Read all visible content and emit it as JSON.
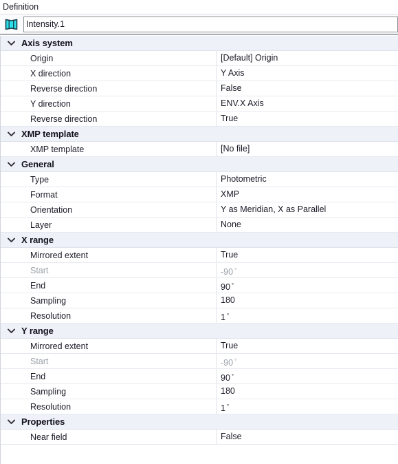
{
  "panel": {
    "title": "Definition"
  },
  "identity": {
    "icon": "light-source-icon",
    "name_value": "Intensity.1",
    "name_placeholder": "Name"
  },
  "icons": {
    "expander": "chevron-down-icon"
  },
  "colors": {
    "icon_fill": "#2ae0ea",
    "icon_stroke": "#1b3a4b",
    "group_row_bg": "#eef2f8",
    "row_border": "#e6eaf0",
    "text": "#1b1b28",
    "disabled_text": "#9aa0a8"
  },
  "groups": [
    {
      "label": "Axis system",
      "expanded": true,
      "rows": [
        {
          "name": "Origin",
          "value": "[Default] Origin",
          "unit": "",
          "disabled": false
        },
        {
          "name": "X direction",
          "value": "Y Axis",
          "unit": "",
          "disabled": false
        },
        {
          "name": "Reverse direction",
          "value": "False",
          "unit": "",
          "disabled": false
        },
        {
          "name": "Y direction",
          "value": "ENV.X Axis",
          "unit": "",
          "disabled": false
        },
        {
          "name": "Reverse direction",
          "value": "True",
          "unit": "",
          "disabled": false
        }
      ]
    },
    {
      "label": "XMP template",
      "expanded": true,
      "rows": [
        {
          "name": "XMP template",
          "value": "[No file]",
          "unit": "",
          "disabled": false
        }
      ]
    },
    {
      "label": "General",
      "expanded": true,
      "rows": [
        {
          "name": "Type",
          "value": "Photometric",
          "unit": "",
          "disabled": false
        },
        {
          "name": "Format",
          "value": "XMP",
          "unit": "",
          "disabled": false
        },
        {
          "name": "Orientation",
          "value": "Y as Meridian, X as Parallel",
          "unit": "",
          "disabled": false
        },
        {
          "name": "Layer",
          "value": "None",
          "unit": "",
          "disabled": false
        }
      ]
    },
    {
      "label": "X range",
      "expanded": true,
      "rows": [
        {
          "name": "Mirrored extent",
          "value": "True",
          "unit": "",
          "disabled": false
        },
        {
          "name": "Start",
          "value": "-90",
          "unit": "°",
          "disabled": true
        },
        {
          "name": "End",
          "value": "90",
          "unit": "°",
          "disabled": false
        },
        {
          "name": "Sampling",
          "value": "180",
          "unit": "",
          "disabled": false
        },
        {
          "name": "Resolution",
          "value": "1",
          "unit": "°",
          "disabled": false
        }
      ]
    },
    {
      "label": "Y range",
      "expanded": true,
      "rows": [
        {
          "name": "Mirrored extent",
          "value": "True",
          "unit": "",
          "disabled": false
        },
        {
          "name": "Start",
          "value": "-90",
          "unit": "°",
          "disabled": true
        },
        {
          "name": "End",
          "value": "90",
          "unit": "°",
          "disabled": false
        },
        {
          "name": "Sampling",
          "value": "180",
          "unit": "",
          "disabled": false
        },
        {
          "name": "Resolution",
          "value": "1",
          "unit": "°",
          "disabled": false
        }
      ]
    },
    {
      "label": "Properties",
      "expanded": true,
      "rows": [
        {
          "name": "Near field",
          "value": "False",
          "unit": "",
          "disabled": false
        }
      ]
    }
  ]
}
